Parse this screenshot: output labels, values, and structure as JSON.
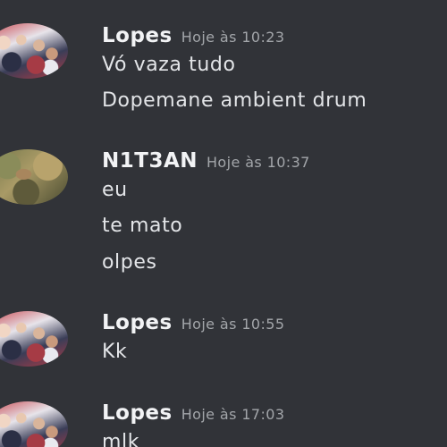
{
  "messages": [
    {
      "author": "Lopes",
      "time": "Hoje às 10:23",
      "lines": [
        "Vó vaza tudo",
        "Dopemane ambient drum"
      ]
    },
    {
      "author": "N1T3AN",
      "time": "Hoje às 10:37",
      "lines": [
        "eu",
        "te mato",
        "olpes"
      ]
    },
    {
      "author": "Lopes",
      "time": "Hoje às 10:55",
      "lines": [
        "Kk"
      ]
    },
    {
      "author": "Lopes",
      "time": "Hoje às 17:03",
      "lines": [
        "mlk"
      ]
    }
  ],
  "colors": {
    "background": "#313338",
    "username": "#f2f3f5",
    "timestamp": "#a3a6aa",
    "message_text": "#e3e5e8"
  }
}
